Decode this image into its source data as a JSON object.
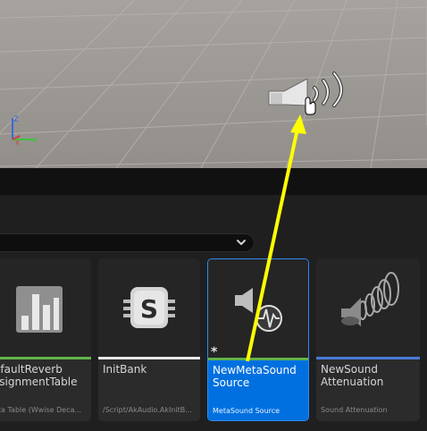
{
  "viewport": {
    "axis": {
      "z_label": "Z",
      "x_label": "X",
      "y_label": "Y"
    },
    "icons": {
      "speaker": "ambient-sound-icon",
      "cursor": "hand-cursor-icon"
    }
  },
  "content_browser": {
    "filter": {
      "icon": "chevron-down-icon"
    },
    "assets": [
      {
        "name": "efaultReverb\nssignmentTable",
        "type": "ata Table (Wwise Deca...",
        "bar_color": "#62b34a",
        "icon": "data-table-icon"
      },
      {
        "name": "InitBank",
        "type": "/Script/AkAudio.AkInitB...",
        "bar_color": "#e8e8e8",
        "icon": "ak-init-bank-icon"
      },
      {
        "name": "NewMetaSound\nSource",
        "type": "MetaSound Source",
        "bar_color": "#62b34a",
        "icon": "metasound-source-icon",
        "selected": true,
        "unsaved_marker": "*"
      },
      {
        "name": "NewSound\nAttenuation",
        "type": "Sound Attenuation",
        "bar_color": "#4a7ad8",
        "icon": "sound-attenuation-icon"
      }
    ]
  },
  "annotation": {
    "arrow_color": "#ffff00"
  }
}
